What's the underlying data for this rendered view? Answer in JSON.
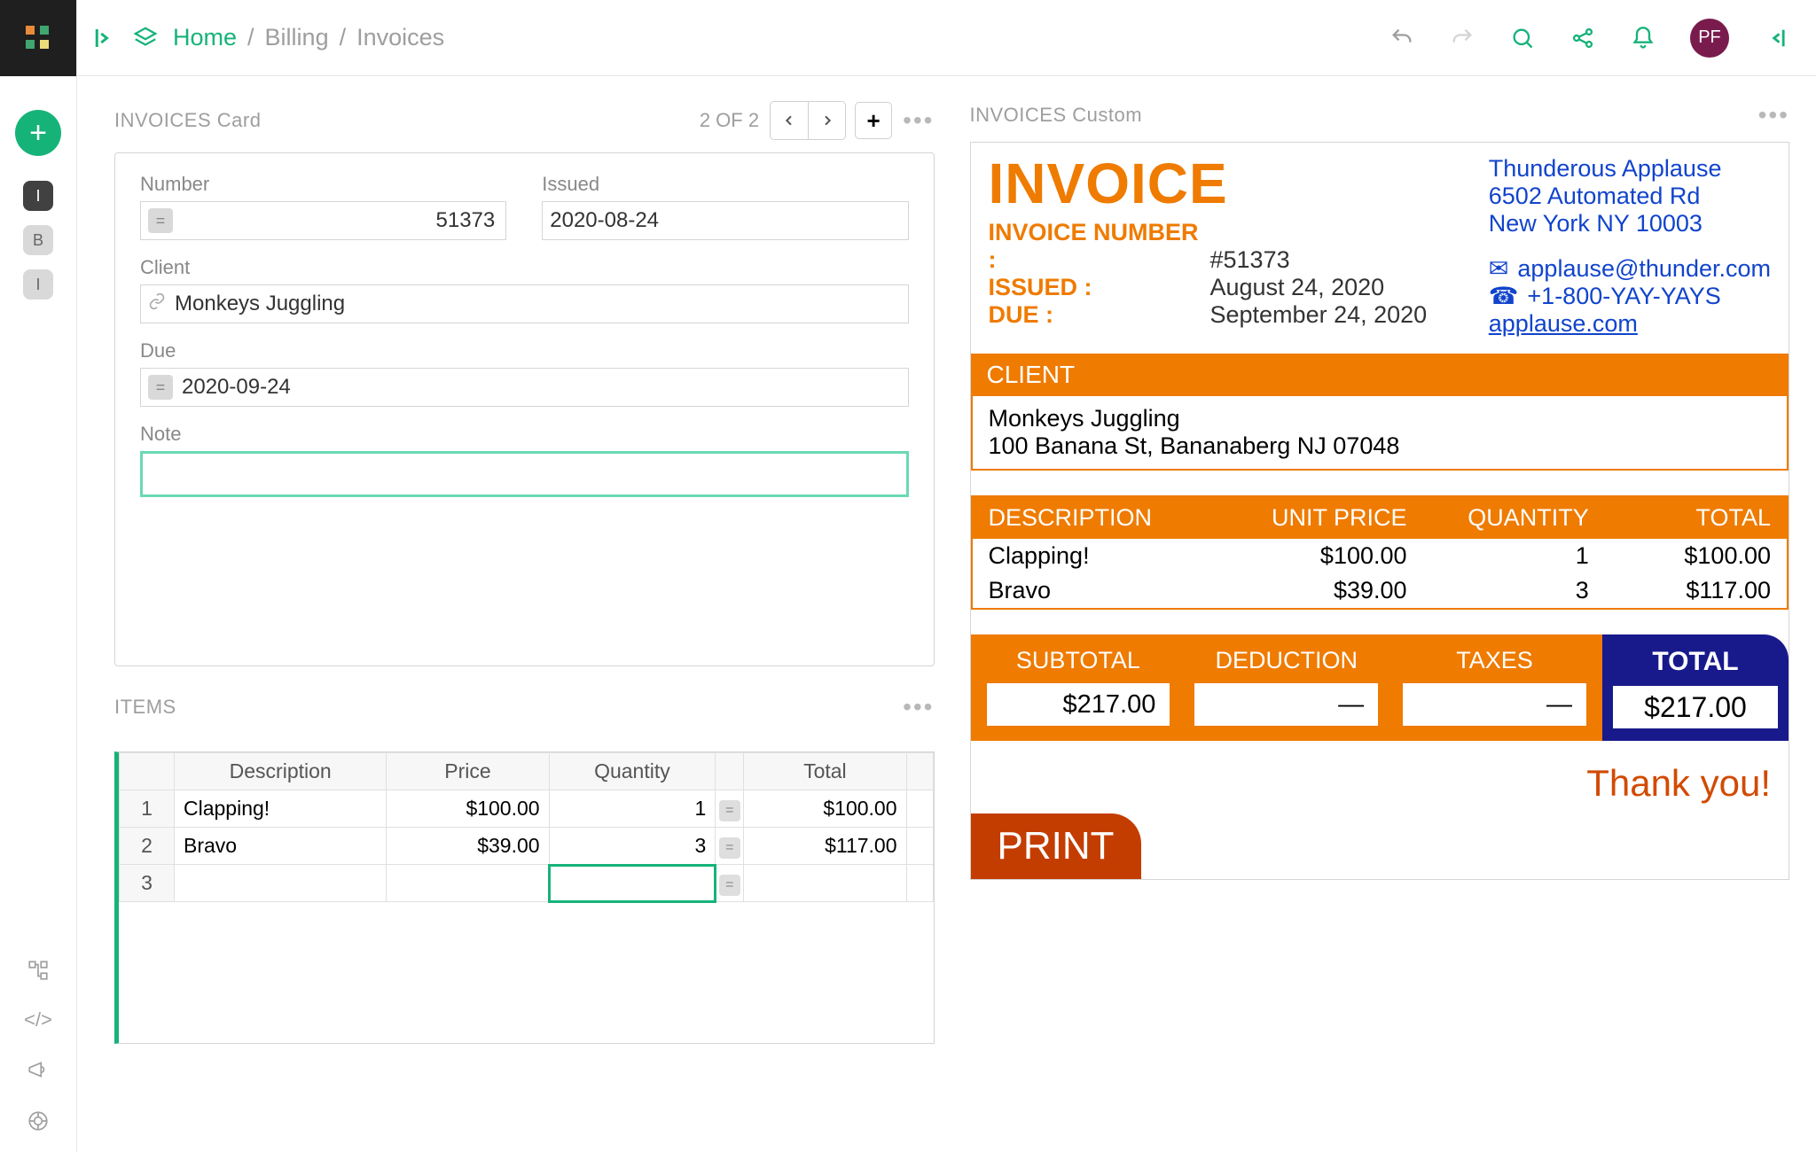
{
  "breadcrumb": {
    "home": "Home",
    "billing": "Billing",
    "invoices": "Invoices"
  },
  "avatar": "PF",
  "sidebar_nav": [
    "I",
    "B",
    "I"
  ],
  "card": {
    "title": "INVOICES Card",
    "pager": "2 OF 2",
    "fields": {
      "number_label": "Number",
      "number": "51373",
      "issued_label": "Issued",
      "issued": "2020-08-24",
      "client_label": "Client",
      "client": "Monkeys Juggling",
      "due_label": "Due",
      "due": "2020-09-24",
      "note_label": "Note",
      "note": ""
    }
  },
  "items": {
    "title": "ITEMS",
    "headers": [
      "Description",
      "Price",
      "Quantity",
      "Total"
    ],
    "rows": [
      {
        "n": "1",
        "desc": "Clapping!",
        "price": "$100.00",
        "qty": "1",
        "total": "$100.00"
      },
      {
        "n": "2",
        "desc": "Bravo",
        "price": "$39.00",
        "qty": "3",
        "total": "$117.00"
      },
      {
        "n": "3",
        "desc": "",
        "price": "",
        "qty": "",
        "total": ""
      }
    ]
  },
  "preview": {
    "title": "INVOICES Custom",
    "heading": "INVOICE",
    "meta": {
      "inv_lbl": "INVOICE NUMBER :",
      "inv_val": "#51373",
      "iss_lbl": "ISSUED :",
      "iss_val": "August 24, 2020",
      "due_lbl": "DUE :",
      "due_val": "September 24, 2020"
    },
    "company": {
      "name": "Thunderous Applause",
      "addr1": "6502 Automated Rd",
      "addr2": "New York NY 10003",
      "email": "applause@thunder.com",
      "phone": "+1-800-YAY-YAYS",
      "site": "applause.com"
    },
    "client_hdr": "CLIENT",
    "client_name": "Monkeys Juggling",
    "client_addr": "100 Banana St, Bananaberg NJ 07048",
    "table": {
      "headers": {
        "desc": "DESCRIPTION",
        "price": "UNIT PRICE",
        "qty": "QUANTITY",
        "tot": "TOTAL"
      },
      "rows": [
        {
          "desc": "Clapping!",
          "price": "$100.00",
          "qty": "1",
          "tot": "$100.00"
        },
        {
          "desc": "Bravo",
          "price": "$39.00",
          "qty": "3",
          "tot": "$117.00"
        }
      ]
    },
    "totals": {
      "subtotal_lbl": "SUBTOTAL",
      "subtotal": "$217.00",
      "deduction_lbl": "DEDUCTION",
      "deduction": "—",
      "taxes_lbl": "TAXES",
      "taxes": "—",
      "total_lbl": "TOTAL",
      "total": "$217.00"
    },
    "thankyou": "Thank you!",
    "print": "PRINT"
  }
}
